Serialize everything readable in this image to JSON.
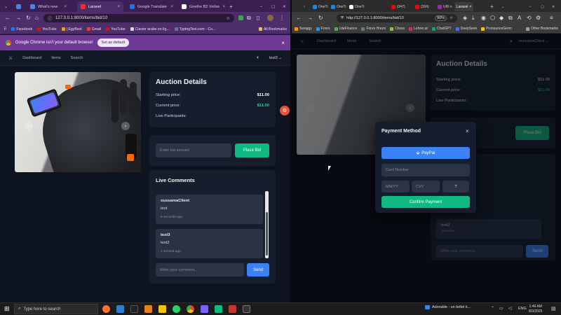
{
  "left_browser": {
    "tabs": [
      {
        "title": "What's new",
        "color": "#4285f4",
        "active": false
      },
      {
        "title": "Laravel",
        "color": "#ff2d20",
        "active": true
      },
      {
        "title": "Google Translate",
        "color": "#1a73e8",
        "active": false
      },
      {
        "title": "Goethe B2 Vorbere...",
        "color": "#ffffff",
        "active": false
      }
    ],
    "url": "127.0.0.1:8000/items/bid/10",
    "bookmarks": [
      "Facebook",
      "YouTube",
      "| EgyBest",
      "Gmail",
      "YouTube",
      "Clavier arabe en lig...",
      "TypingTest.com - Co...",
      "All Bookmarks"
    ],
    "infobar": {
      "message": "Google Chrome isn't your default browser",
      "button": "Set as default"
    }
  },
  "app": {
    "nav": {
      "dashboard": "Dashboard",
      "items": "Items",
      "search": "Search",
      "user": "test3"
    },
    "auction": {
      "title": "Auction Details",
      "starting_label": "Starting price:",
      "starting_value": "$11.00",
      "current_label": "Current price:",
      "current_value": "$11.00",
      "participants_label": "Live Participants:"
    },
    "bid": {
      "placeholder": "Enter bid amount",
      "button": "Place Bid"
    },
    "comments": {
      "title": "Live Comments",
      "items": [
        {
          "user": "oussamaClient",
          "text": "test",
          "time": "8 seconds ago"
        },
        {
          "user": "test3",
          "text": "test2",
          "time": "1 second ago"
        }
      ],
      "placeholder": "Write your comment...",
      "send": "Send"
    }
  },
  "right_browser": {
    "tabs": [
      "OneTi",
      "OneTi",
      "OneTi",
      "(347)",
      "(354)",
      "URI n",
      "Laravel"
    ],
    "url": "http://127.0.0.1:8000/items/bid/10",
    "zoom": "90%",
    "bookmarks": [
      "Swaggy",
      "Forex",
      "LiteFinance",
      "Forex Hours",
      "Chess",
      "Lehrer.at",
      "ChatGPT",
      "DeepSeek",
      "PronounceGerm",
      "Other Bookmarks"
    ],
    "app_user": "oussamaClient",
    "comment_preview": {
      "user": "test2",
      "time": "Just now"
    },
    "comment_placeholder": "Write your comment...",
    "send": "Send",
    "place_bid": "Place Bid",
    "modal": {
      "title": "Payment Method",
      "paypal": "PayPal",
      "card_placeholder": "Card Number",
      "expiry_placeholder": "MM/YY",
      "cvv_placeholder": "CVV",
      "help": "?",
      "confirm": "Confirm Payment"
    }
  },
  "taskbar": {
    "search_placeholder": "Type here to search",
    "media": "Adorable : un bébé k...",
    "lang": "ENG",
    "time": "1:46 AM",
    "date": "8/3/2025"
  },
  "colors": {
    "accent_green": "#10b981",
    "accent_blue": "#3b82f6",
    "chrome_purple": "#4e2d6b"
  }
}
